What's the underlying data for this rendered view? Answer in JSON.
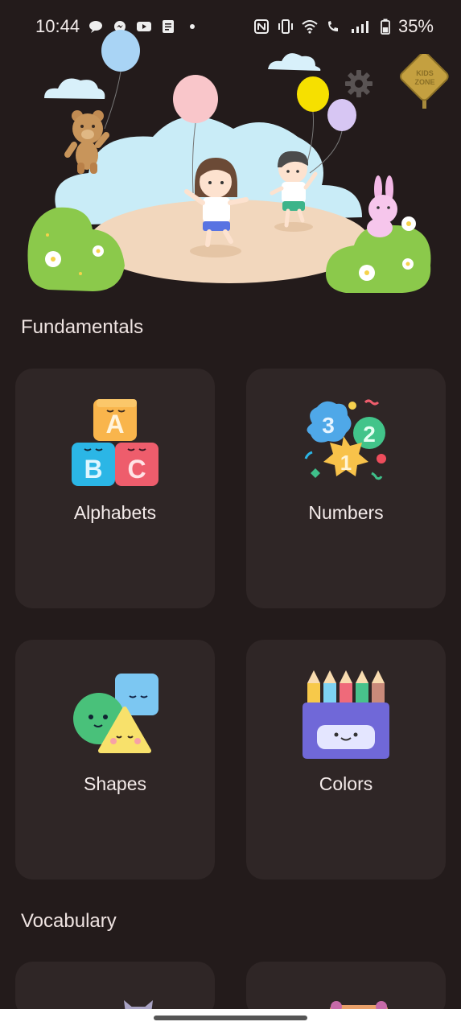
{
  "status_bar": {
    "time": "10:44",
    "battery": "35%",
    "left_icons": [
      "chat-bubble-icon",
      "messenger-icon",
      "youtube-icon",
      "notes-icon",
      "dot-icon"
    ],
    "right_icons": [
      "nfc-icon",
      "vibrate-icon",
      "wifi-icon",
      "wifi-call-icon",
      "signal-icon",
      "battery-icon"
    ]
  },
  "hero": {
    "badge_text_line1": "KIDS",
    "badge_text_line2": "ZONE"
  },
  "sections": {
    "fundamentals": "Fundamentals",
    "vocabulary": "Vocabulary"
  },
  "cards": {
    "alphabets": "Alphabets",
    "numbers": "Numbers",
    "shapes": "Shapes",
    "colors": "Colors"
  },
  "colors": {
    "background": "#231b1b",
    "card": "#2f2626",
    "text": "#f4ebea"
  }
}
